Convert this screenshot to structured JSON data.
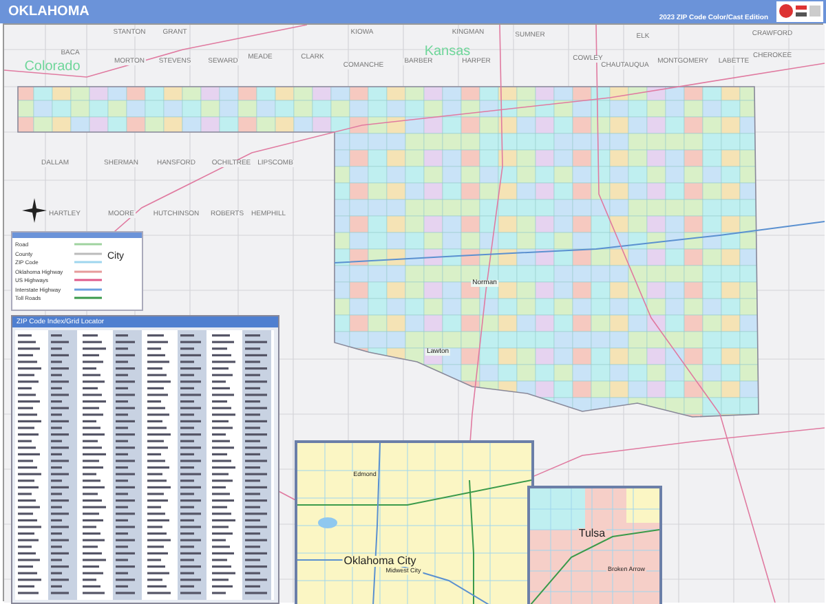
{
  "header": {
    "title": "OKLAHOMA",
    "edition": "2023 ZIP Code Color/Cast Edition"
  },
  "state_labels": [
    "Colorado",
    "Kansas"
  ],
  "county_labels": [
    "BACA",
    "STANTON",
    "GRANT",
    "MORTON",
    "STEVENS",
    "SEWARD",
    "MEADE",
    "CLARK",
    "KIOWA",
    "COMANCHE",
    "BARBER",
    "KINGMAN",
    "HARPER",
    "SUMNER",
    "COWLEY",
    "ELK",
    "CHAUTAUQUA",
    "MONTGOMERY",
    "LABETTE",
    "CRAWFORD",
    "CHEROKEE",
    "DALLAM",
    "SHERMAN",
    "HANSFORD",
    "OCHILTREE",
    "LIPSCOMB",
    "HARTLEY",
    "MOORE",
    "HUTCHINSON",
    "ROBERTS",
    "HEMPHILL"
  ],
  "city_labels": [
    "Norman",
    "Lawton"
  ],
  "legend": {
    "items": [
      "Road",
      "County",
      "ZIP Code",
      "Oklahoma Highway",
      "US Highways",
      "Interstate Highway",
      "Toll Roads"
    ],
    "city_sample": "City"
  },
  "zip_index": {
    "title": "ZIP Code Index/Grid Locator"
  },
  "insets": [
    {
      "labels": [
        "Edmond",
        "Oklahoma City",
        "Midwest City"
      ]
    },
    {
      "labels": [
        "Tulsa",
        "Broken Arrow"
      ]
    }
  ]
}
